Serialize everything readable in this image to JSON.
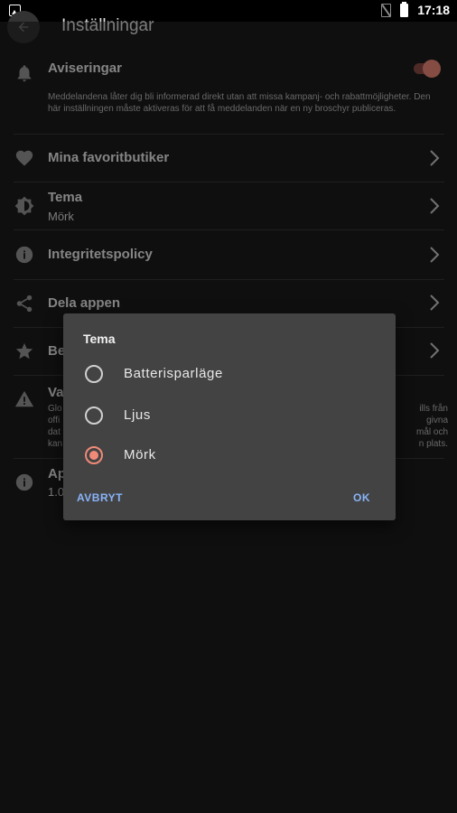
{
  "status_bar": {
    "time": "17:18"
  },
  "app_bar": {
    "title": "Inställningar"
  },
  "settings": {
    "notifications": {
      "title": "Aviseringar",
      "description": "Meddelandena låter dig bli informerad direkt utan att missa kampanj- och rabattmöjligheter. Den här inställningen måste aktiveras för att få meddelanden när en ny broschyr publiceras.",
      "enabled": true
    },
    "favorites": {
      "title": "Mina favoritbutiker"
    },
    "theme": {
      "title": "Tema",
      "value": "Mörk"
    },
    "privacy": {
      "title": "Integritetspolicy"
    },
    "share": {
      "title": "Dela appen"
    },
    "rate": {
      "title_visible": "Be"
    },
    "warning": {
      "title_visible": "Va",
      "desc_left": [
        "Glo",
        "offi",
        "dat",
        "kan"
      ],
      "desc_right": [
        "ills från",
        "givna",
        "mål och",
        "n plats."
      ]
    },
    "about": {
      "title_visible": "Ap",
      "version_visible": "1.0"
    }
  },
  "dialog": {
    "title": "Tema",
    "options": [
      {
        "label": "Batterisparläge",
        "selected": false
      },
      {
        "label": "Ljus",
        "selected": false
      },
      {
        "label": "Mörk",
        "selected": true
      }
    ],
    "cancel_label": "AVBRYT",
    "ok_label": "OK"
  },
  "colors": {
    "accent": "#f08a78",
    "dialog_button": "#8ab4f8",
    "background": "#1c1c1d",
    "dialog_background": "#434344"
  }
}
